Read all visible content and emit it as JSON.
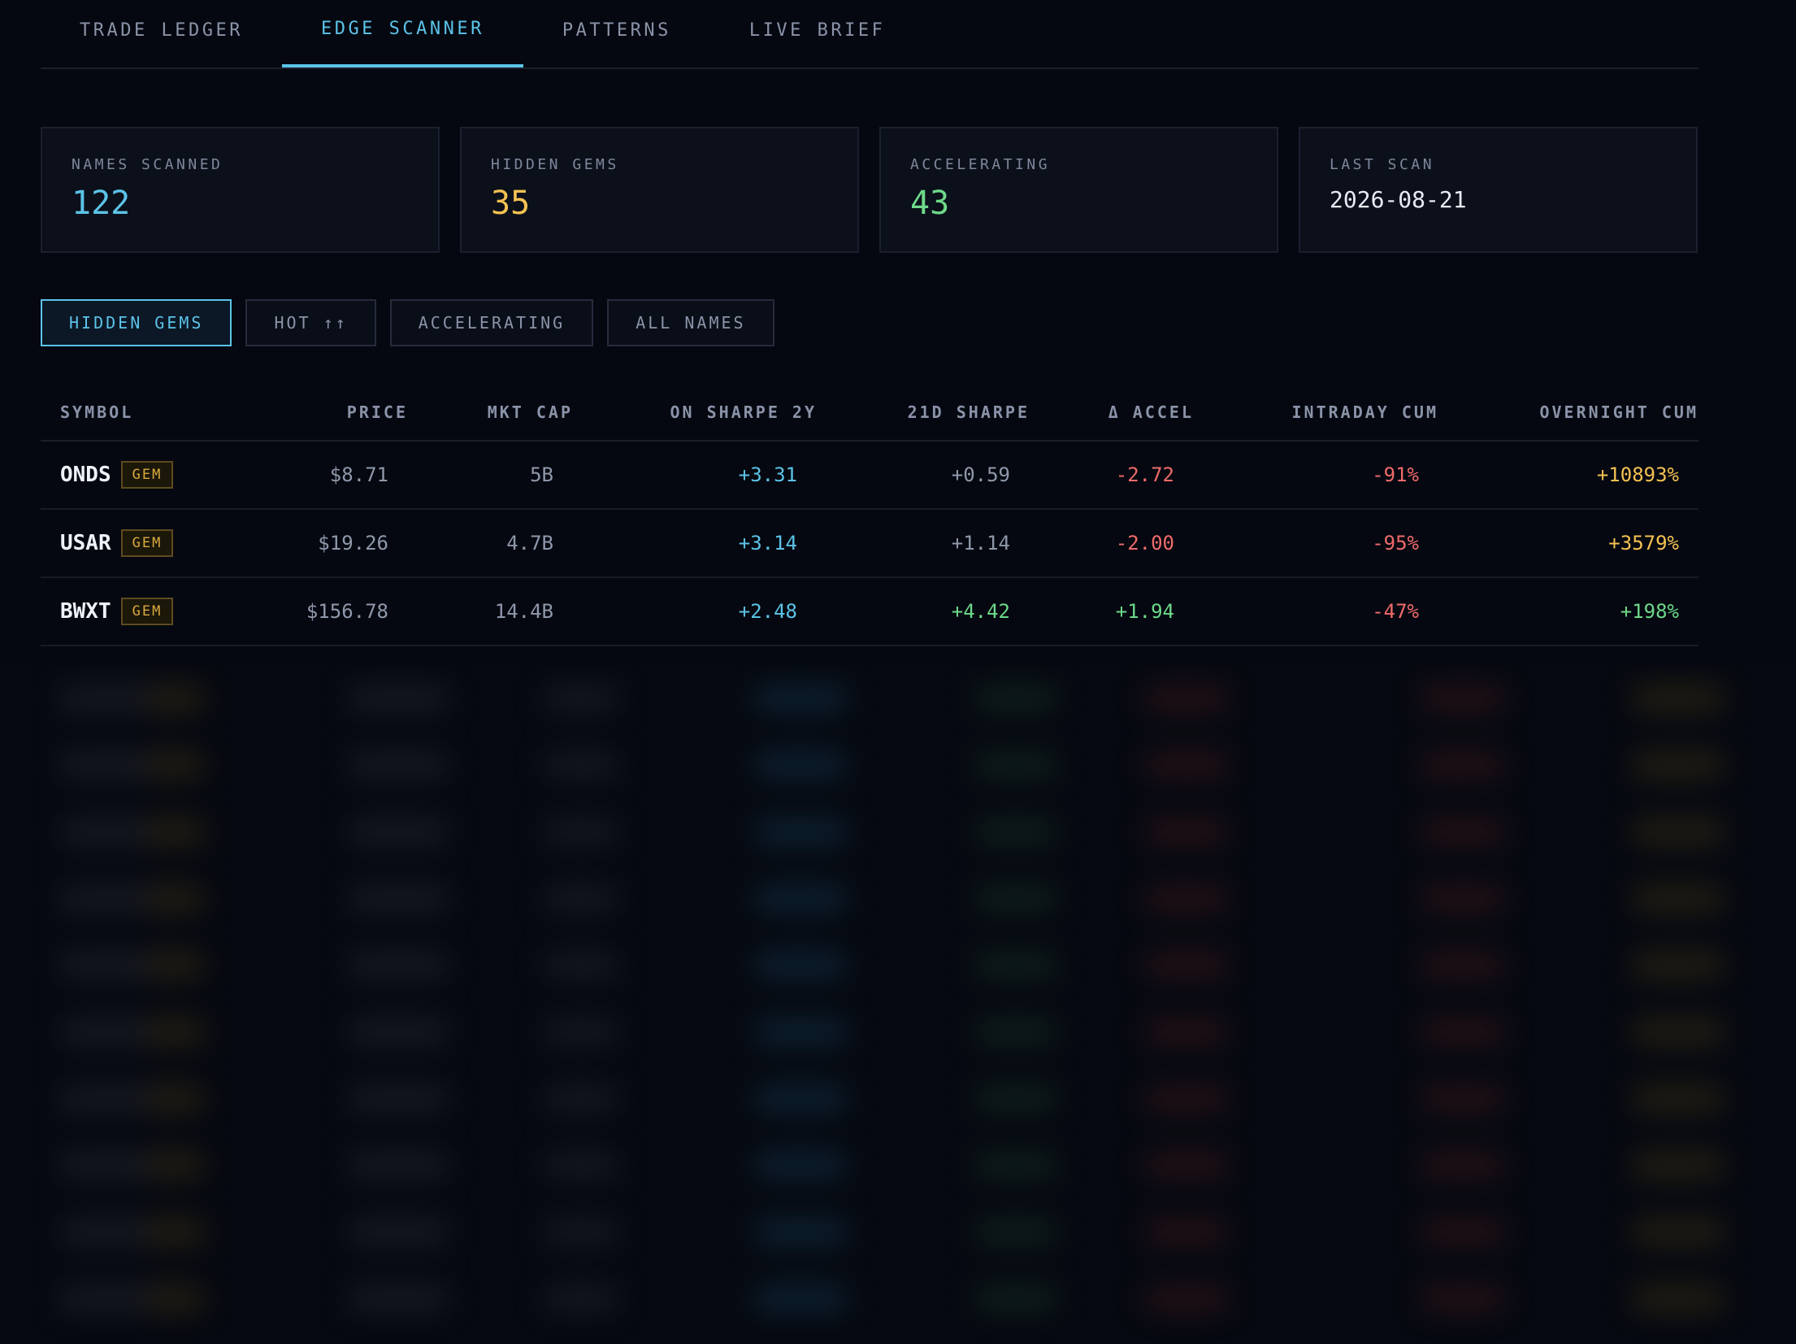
{
  "tabs": [
    {
      "label": "TRADE LEDGER",
      "active": false
    },
    {
      "label": "EDGE SCANNER",
      "active": true
    },
    {
      "label": "PATTERNS",
      "active": false
    },
    {
      "label": "LIVE BRIEF",
      "active": false
    }
  ],
  "stats": {
    "names_scanned": {
      "label": "NAMES SCANNED",
      "value": "122"
    },
    "hidden_gems": {
      "label": "HIDDEN GEMS",
      "value": "35"
    },
    "accelerating": {
      "label": "ACCELERATING",
      "value": "43"
    },
    "last_scan": {
      "label": "LAST SCAN",
      "value": "2026-08-21"
    }
  },
  "filters": [
    {
      "label": "HIDDEN GEMS",
      "active": true
    },
    {
      "label": "HOT ↑↑",
      "active": false
    },
    {
      "label": "ACCELERATING",
      "active": false
    },
    {
      "label": "ALL NAMES",
      "active": false
    }
  ],
  "table": {
    "columns": [
      "SYMBOL",
      "PRICE",
      "MKT CAP",
      "ON SHARPE 2Y",
      "21D SHARPE",
      "Δ ACCEL",
      "INTRADAY CUM",
      "OVERNIGHT CUM"
    ],
    "rows": [
      {
        "symbol": "ONDS",
        "badge": "GEM",
        "price": "$8.71",
        "mkt_cap": "5B",
        "on_sharpe_2y": "+3.31",
        "sharpe_21d": "+0.59",
        "accel": "-2.72",
        "intraday_cum": "-91%",
        "overnight_cum": "+10893%"
      },
      {
        "symbol": "USAR",
        "badge": "GEM",
        "price": "$19.26",
        "mkt_cap": "4.7B",
        "on_sharpe_2y": "+3.14",
        "sharpe_21d": "+1.14",
        "accel": "-2.00",
        "intraday_cum": "-95%",
        "overnight_cum": "+3579%"
      },
      {
        "symbol": "BWXT",
        "badge": "GEM",
        "price": "$156.78",
        "mkt_cap": "14.4B",
        "on_sharpe_2y": "+2.48",
        "sharpe_21d": "+4.42",
        "accel": "+1.94",
        "intraday_cum": "-47%",
        "overnight_cum": "+198%"
      }
    ]
  },
  "colors": {
    "accent": "#5cc3e8",
    "gem": "#f4c152",
    "positive": "#6ed98a",
    "negative": "#ef6b6b",
    "background": "#050810"
  }
}
